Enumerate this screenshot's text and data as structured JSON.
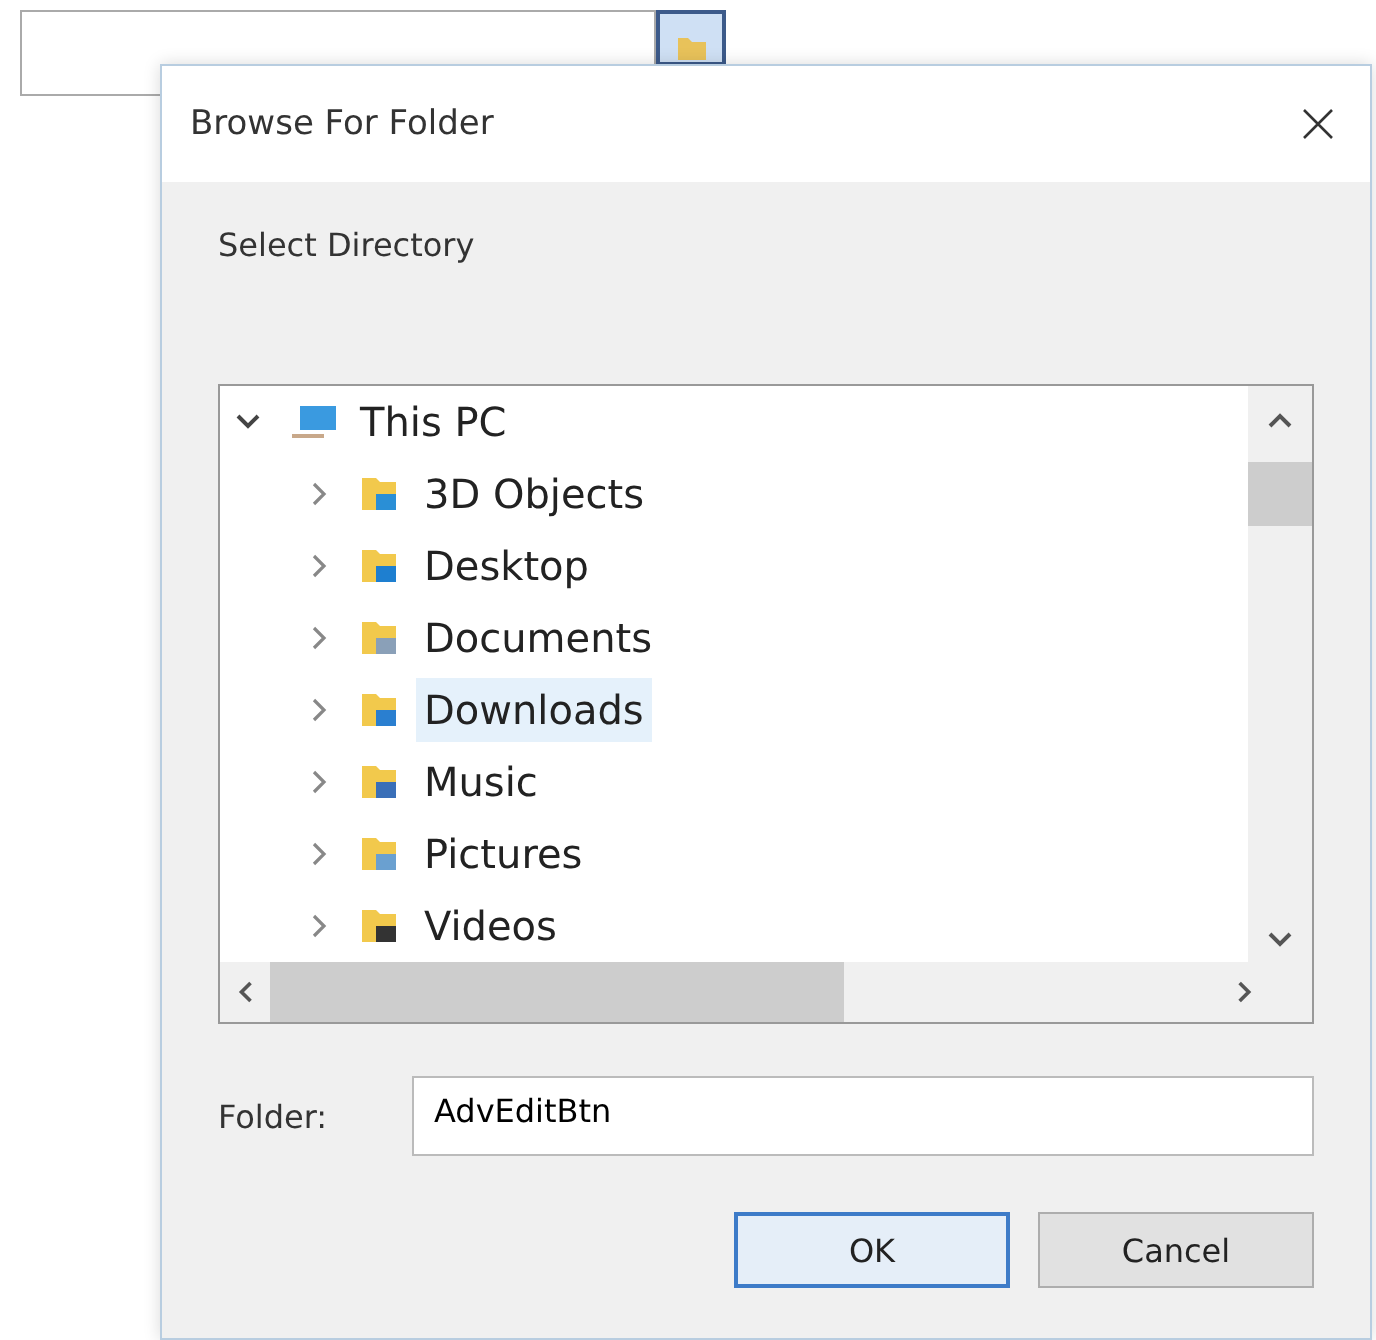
{
  "dialog": {
    "title": "Browse For Folder",
    "instruction": "Select Directory",
    "tree": [
      {
        "label": "This PC",
        "expanded": true,
        "selected": false,
        "children": [
          {
            "label": "3D Objects",
            "expanded": false,
            "selected": false
          },
          {
            "label": "Desktop",
            "expanded": false,
            "selected": false
          },
          {
            "label": "Documents",
            "expanded": false,
            "selected": false
          },
          {
            "label": "Downloads",
            "expanded": false,
            "selected": true
          },
          {
            "label": "Music",
            "expanded": false,
            "selected": false
          },
          {
            "label": "Pictures",
            "expanded": false,
            "selected": false
          },
          {
            "label": "Videos",
            "expanded": false,
            "selected": false
          }
        ]
      }
    ],
    "folder_label": "Folder:",
    "folder_value": "AdvEditBtn",
    "buttons": [
      {
        "label": "OK",
        "default": true
      },
      {
        "label": "Cancel",
        "default": false
      }
    ]
  }
}
